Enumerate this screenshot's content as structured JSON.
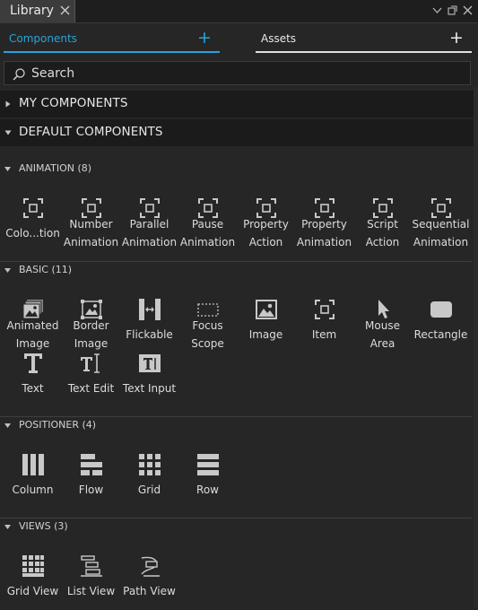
{
  "window": {
    "tab_label": "Library",
    "colors": {
      "background": "#262626",
      "section_bg": "#1b1b1b",
      "accent": "#2aa3d8",
      "icon": "#c8c8c8"
    }
  },
  "tabs": {
    "components": {
      "label": "Components",
      "plus": "+",
      "active": true
    },
    "assets": {
      "label": "Assets",
      "plus": "+",
      "active": false
    }
  },
  "search": {
    "placeholder": "Search",
    "value": ""
  },
  "sections": {
    "my_components": {
      "label": "MY COMPONENTS",
      "expanded": false
    },
    "default_components": {
      "label": "DEFAULT COMPONENTS",
      "expanded": true
    }
  },
  "categories": {
    "animation": {
      "label": "ANIMATION (8)",
      "items": [
        {
          "line1": "Colo...tion",
          "line2": "",
          "icon": "frame-icon"
        },
        {
          "line1": "Number",
          "line2": "Animation",
          "icon": "frame-icon"
        },
        {
          "line1": "Parallel",
          "line2": "Animation",
          "icon": "frame-icon"
        },
        {
          "line1": "Pause",
          "line2": "Animation",
          "icon": "frame-icon"
        },
        {
          "line1": "Property",
          "line2": "Action",
          "icon": "frame-icon"
        },
        {
          "line1": "Property",
          "line2": "Animation",
          "icon": "frame-icon"
        },
        {
          "line1": "Script",
          "line2": "Action",
          "icon": "frame-icon"
        },
        {
          "line1": "Sequential",
          "line2": "Animation",
          "icon": "frame-icon"
        }
      ]
    },
    "basic": {
      "label": "BASIC (11)",
      "items": [
        {
          "line1": "Animated",
          "line2": "Image",
          "icon": "animated-image-icon"
        },
        {
          "line1": "Border",
          "line2": "Image",
          "icon": "border-image-icon"
        },
        {
          "line1": "Flickable",
          "line2": "",
          "icon": "flickable-icon"
        },
        {
          "line1": "Focus",
          "line2": "Scope",
          "icon": "focus-scope-icon"
        },
        {
          "line1": "Image",
          "line2": "",
          "icon": "image-icon"
        },
        {
          "line1": "Item",
          "line2": "",
          "icon": "item-icon"
        },
        {
          "line1": "Mouse",
          "line2": "Area",
          "icon": "mouse-area-icon"
        },
        {
          "line1": "Rectangle",
          "line2": "",
          "icon": "rectangle-icon"
        },
        {
          "line1": "Text",
          "line2": "",
          "icon": "text-icon"
        },
        {
          "line1": "Text Edit",
          "line2": "",
          "icon": "text-edit-icon"
        },
        {
          "line1": "Text Input",
          "line2": "",
          "icon": "text-input-icon"
        }
      ]
    },
    "positioner": {
      "label": "POSITIONER (4)",
      "items": [
        {
          "line1": "Column",
          "line2": "",
          "icon": "column-icon"
        },
        {
          "line1": "Flow",
          "line2": "",
          "icon": "flow-icon"
        },
        {
          "line1": "Grid",
          "line2": "",
          "icon": "grid-icon"
        },
        {
          "line1": "Row",
          "line2": "",
          "icon": "row-icon"
        }
      ]
    },
    "views": {
      "label": "VIEWS (3)",
      "items": [
        {
          "line1": "Grid View",
          "line2": "",
          "icon": "grid-view-icon"
        },
        {
          "line1": "List View",
          "line2": "",
          "icon": "list-view-icon"
        },
        {
          "line1": "Path View",
          "line2": "",
          "icon": "path-view-icon"
        }
      ]
    }
  }
}
